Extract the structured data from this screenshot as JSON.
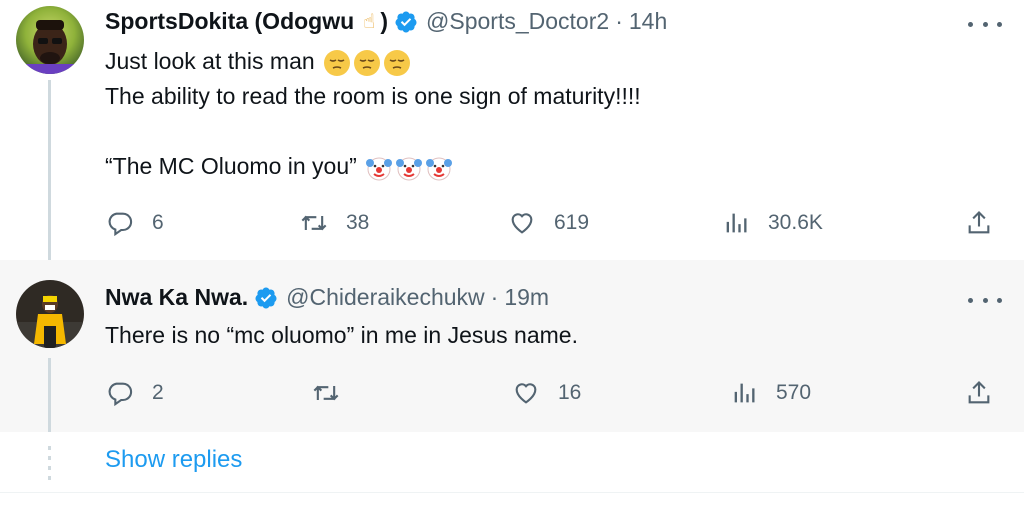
{
  "tweets": [
    {
      "display_name": "SportsDokita (Odogwu",
      "name_emoji": "☝",
      "name_close": ")",
      "handle": "@Sports_Doctor2",
      "separator": "·",
      "time": "14h",
      "text_line_1": "Just look at this man",
      "text_line_2": "The ability to read the room is one sign of maturity!!!!",
      "text_line_3": "“The MC Oluomo in you”",
      "reply_count": "6",
      "retweet_count": "38",
      "like_count": "619",
      "view_count": "30.6K"
    },
    {
      "display_name": "Nwa Ka Nwa.",
      "handle": "@Chideraikechukw",
      "separator": "·",
      "time": "19m",
      "text_line_1": "There is no “mc oluomo” in me in Jesus name.",
      "reply_count": "2",
      "retweet_count": "",
      "like_count": "16",
      "view_count": "570"
    }
  ],
  "show_replies_label": "Show replies",
  "colors": {
    "accent": "#1d9bf0",
    "secondary_text": "#536471",
    "thread_line": "#cfd9de",
    "reply_background": "#f7f7f7"
  },
  "icons": [
    "reply-icon",
    "retweet-icon",
    "like-icon",
    "views-icon",
    "share-icon",
    "more-icon",
    "verified-badge-icon",
    "pensive-face-emoji",
    "clown-face-emoji",
    "pointing-up-emoji"
  ]
}
